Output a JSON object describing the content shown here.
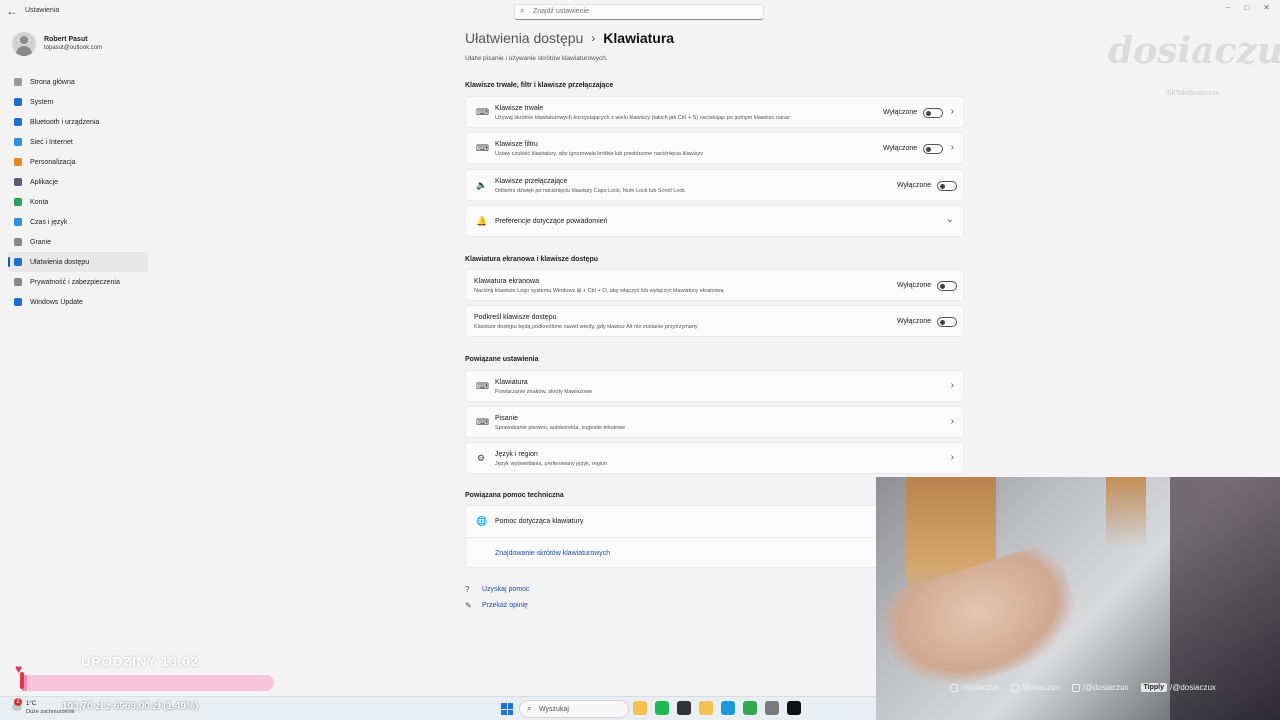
{
  "window": {
    "title": "Ustawienia",
    "back_icon": "back-arrow-icon"
  },
  "search": {
    "placeholder": "Znajdź ustawienie"
  },
  "window_controls": [
    "–",
    "□",
    "✕"
  ],
  "profile": {
    "name": "Robert Pasut",
    "email": "topasut@outlook.com"
  },
  "nav": [
    {
      "label": "Strona główna",
      "icon": "home-icon",
      "color": "#9a9a9a"
    },
    {
      "label": "System",
      "icon": "system-icon",
      "color": "#1f6fd1"
    },
    {
      "label": "Bluetooth i urządzenia",
      "icon": "bluetooth-icon",
      "color": "#1f6fd1"
    },
    {
      "label": "Sieć i Internet",
      "icon": "network-icon",
      "color": "#2f8fe0"
    },
    {
      "label": "Personalizacja",
      "icon": "brush-icon",
      "color": "#e38a2a"
    },
    {
      "label": "Aplikacje",
      "icon": "apps-icon",
      "color": "#5a5a7a"
    },
    {
      "label": "Konta",
      "icon": "account-icon",
      "color": "#2aa05a"
    },
    {
      "label": "Czas i język",
      "icon": "clock-globe-icon",
      "color": "#2f8fe0"
    },
    {
      "label": "Granie",
      "icon": "gaming-icon",
      "color": "#8a8a8a"
    },
    {
      "label": "Ułatwienia dostępu",
      "icon": "accessibility-icon",
      "color": "#1f6fd1",
      "active": true
    },
    {
      "label": "Prywatność i zabezpieczenia",
      "icon": "shield-icon",
      "color": "#8a8a8a"
    },
    {
      "label": "Windows Update",
      "icon": "update-icon",
      "color": "#1f6fd1"
    }
  ],
  "breadcrumb": {
    "parent": "Ułatwienia dostępu",
    "separator": "›",
    "current": "Klawiatura"
  },
  "subtitle": "Ułatw pisanie i używanie skrótów klawiaturowych.",
  "sections": {
    "s1": {
      "title": "Klawisze trwałe, filtr i klawisze przełączające",
      "items": [
        {
          "title": "Klawisze trwałe",
          "desc": "Używaj skrótów klawiaturowych korzystających z wielu klawiszy (takich jak Ctrl + S) naciskając po jednym klawiszu naraz",
          "state": "Wyłączone",
          "icon": "sticky-keys-icon",
          "glyph": "⌨"
        },
        {
          "title": "Klawisze filtru",
          "desc": "Ustaw czułość klawiatury, aby ignorowała krótkie lub powtórzone naciśnięcia klawiszy",
          "state": "Wyłączone",
          "icon": "filter-keys-icon",
          "glyph": "⌨"
        },
        {
          "title": "Klawisze przełączające",
          "desc": "Odtwórz dźwięk po naciśnięciu klawiszy Caps Lock, Num Lock lub Scroll Lock",
          "state": "Wyłączone",
          "icon": "speaker-icon",
          "glyph": "🔈"
        },
        {
          "title": "Preferencje dotyczące powiadomień",
          "icon": "bell-icon",
          "glyph": "🔔"
        }
      ]
    },
    "s2": {
      "title": "Klawiatura ekranowa i klawisze dostępu",
      "items": [
        {
          "title": "Klawiatura ekranowa",
          "desc": "Naciśnij klawisze Logo systemu Windows ⊞ + Ctrl + O, aby włączyć lub wyłączyć klawiaturę ekranową",
          "state": "Wyłączone"
        },
        {
          "title": "Podkreśl klawisze dostępu",
          "desc": "Klawisze dostępu będą podkreślone nawet wtedy, gdy klawisz Alt nie zostanie przytrzymany",
          "state": "Wyłączone"
        }
      ]
    },
    "s3": {
      "title": "Powiązane ustawienia",
      "items": [
        {
          "title": "Klawiatura",
          "desc": "Powtarzanie znaków, skróty klawiszowe",
          "icon": "keyboard-icon",
          "glyph": "⌨"
        },
        {
          "title": "Pisanie",
          "desc": "Sprawdzanie pisowni, autokorekta, sugestie tekstowe",
          "icon": "typing-icon",
          "glyph": "⌨"
        },
        {
          "title": "Język i region",
          "desc": "Język wyświetlania, preferowany język, region",
          "icon": "language-icon",
          "glyph": "⚙"
        }
      ]
    },
    "s4": {
      "title": "Powiązana pomoc techniczna",
      "help_title": "Pomoc dotycząca klawiatury",
      "help_glyph": "🌐",
      "link": "Znajdowanie skrótów klawiaturowych"
    }
  },
  "footer_links": [
    {
      "label": "Uzyskaj pomoc",
      "icon": "help-icon",
      "glyph": "?"
    },
    {
      "label": "Przekaż opinię",
      "icon": "feedback-icon",
      "glyph": "✎"
    }
  ],
  "watermark": {
    "big": "dosiaczux",
    "small": "TikTok/dosiaczux"
  },
  "webcam": {
    "socials": [
      {
        "label": "/dosiaczux",
        "icon": "instagram-icon"
      },
      {
        "label": "/dosiaczux",
        "icon": "x-icon"
      },
      {
        "label": "/@dosiaczux",
        "icon": "youtube-icon"
      },
      {
        "label": "/@dosiaczux",
        "icon": "tipply-icon",
        "badge": "Tipply"
      }
    ]
  },
  "goal": {
    "title": "URODZINY 13.02",
    "text": "103,70 zł z 6969,00 zł  (1.49%)",
    "progress": 0.0149
  },
  "taskbar": {
    "weather": {
      "badge": "2",
      "temp": "1°C",
      "condition": "Duże zachmurzenie"
    },
    "search": "Wyszukaj",
    "apps": [
      {
        "name": "file-explorer-app-icon",
        "color": "#f2c14e"
      },
      {
        "name": "spotify-app-icon",
        "color": "#1db954"
      },
      {
        "name": "obs-app-icon",
        "color": "#333333"
      },
      {
        "name": "folder-app-icon",
        "color": "#f2c14e"
      },
      {
        "name": "edge-app-icon",
        "color": "#1a9bd7"
      },
      {
        "name": "chrome-app-icon",
        "color": "#34a853"
      },
      {
        "name": "settings-app-icon",
        "color": "#7a7a7a"
      },
      {
        "name": "unreal-app-icon",
        "color": "#111111"
      }
    ]
  }
}
